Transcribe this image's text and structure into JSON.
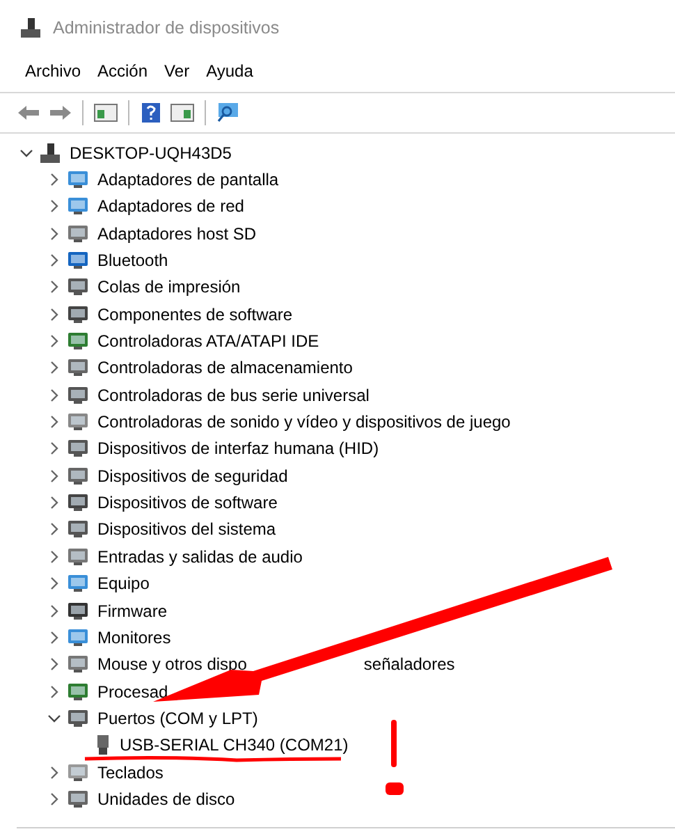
{
  "window": {
    "title": "Administrador de dispositivos"
  },
  "menu": [
    "Archivo",
    "Acción",
    "Ver",
    "Ayuda"
  ],
  "tree": {
    "label": "DESKTOP-UQH43D5",
    "expanded": true,
    "children": [
      {
        "label": "Adaptadores de pantalla",
        "expanded": false
      },
      {
        "label": "Adaptadores de red",
        "expanded": false
      },
      {
        "label": "Adaptadores host SD",
        "expanded": false
      },
      {
        "label": "Bluetooth",
        "expanded": false
      },
      {
        "label": "Colas de impresión",
        "expanded": false
      },
      {
        "label": "Componentes de software",
        "expanded": false
      },
      {
        "label": "Controladoras ATA/ATAPI IDE",
        "expanded": false
      },
      {
        "label": "Controladoras de almacenamiento",
        "expanded": false
      },
      {
        "label": "Controladoras de bus serie universal",
        "expanded": false
      },
      {
        "label": "Controladoras de sonido y vídeo y dispositivos de juego",
        "expanded": false
      },
      {
        "label": "Dispositivos de interfaz humana (HID)",
        "expanded": false
      },
      {
        "label": "Dispositivos de seguridad",
        "expanded": false
      },
      {
        "label": "Dispositivos de software",
        "expanded": false
      },
      {
        "label": "Dispositivos del sistema",
        "expanded": false
      },
      {
        "label": "Entradas y salidas de audio",
        "expanded": false
      },
      {
        "label": "Equipo",
        "expanded": false
      },
      {
        "label": "Firmware",
        "expanded": false
      },
      {
        "label": "Monitores",
        "expanded": false
      },
      {
        "label": "Mouse y otros dispo",
        "label_tail": "señaladores",
        "expanded": false
      },
      {
        "label": "Procesad",
        "expanded": false
      },
      {
        "label": "Puertos (COM y LPT)",
        "expanded": true,
        "children": [
          {
            "label": "USB-SERIAL CH340 (COM21)"
          }
        ]
      },
      {
        "label": "Teclados",
        "expanded": false
      },
      {
        "label": "Unidades de disco",
        "expanded": false
      }
    ]
  }
}
